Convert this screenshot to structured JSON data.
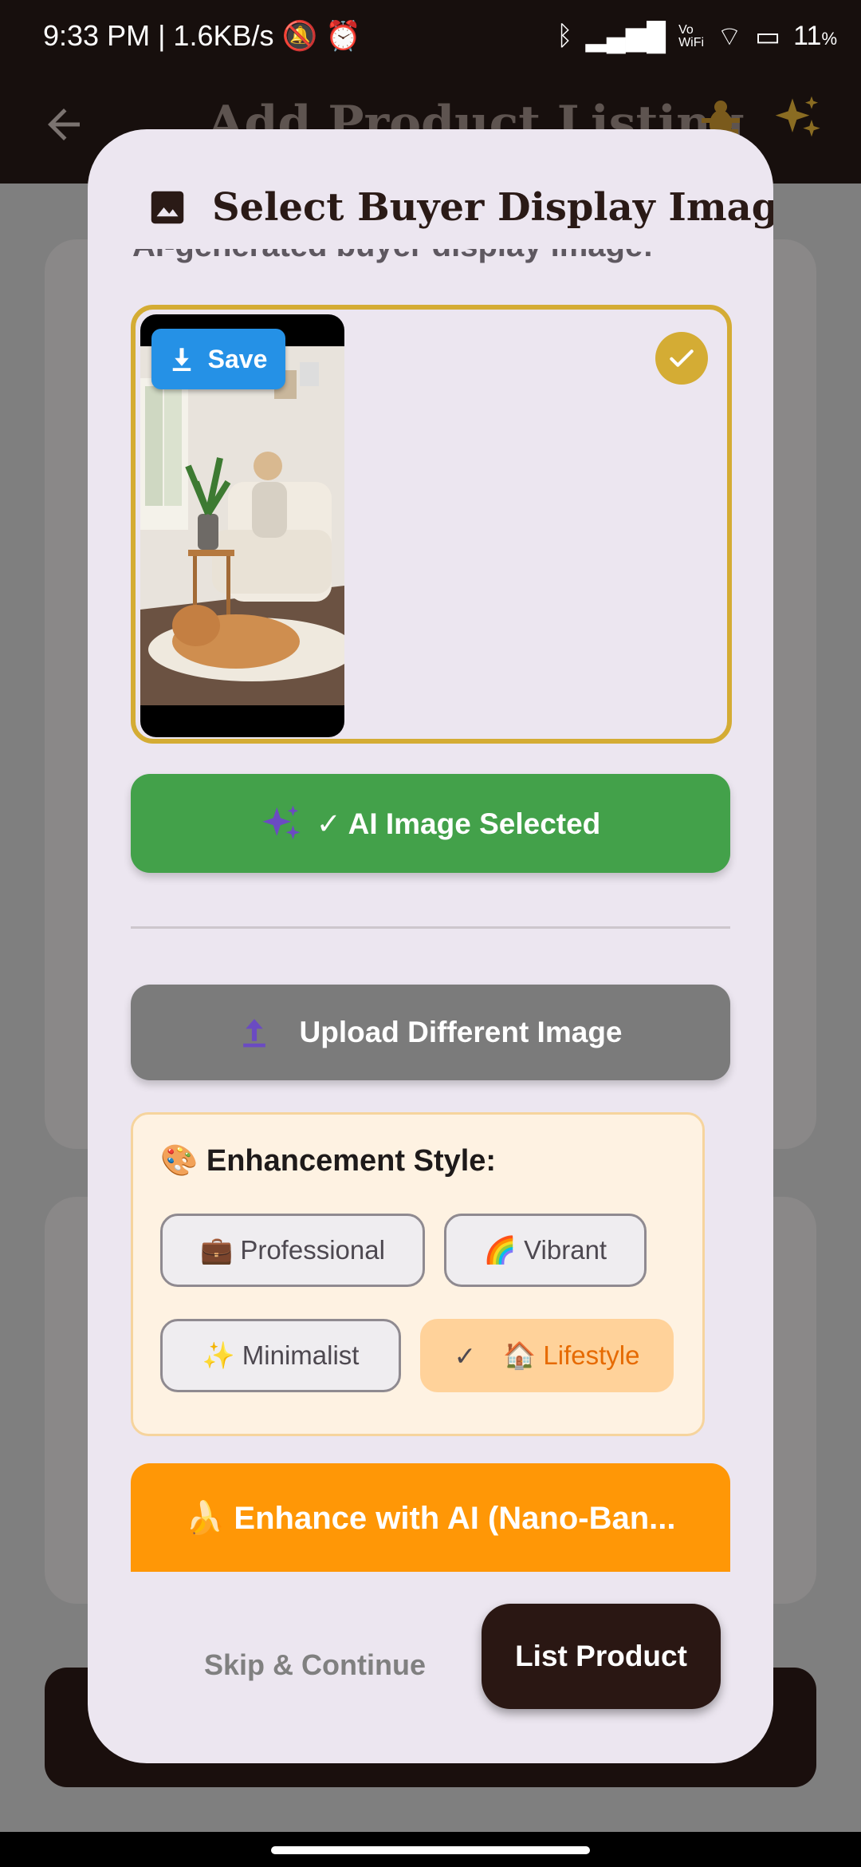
{
  "status_bar": {
    "time_speed": "9:33 PM | 1.6KB/s",
    "vo_wifi_label": "Vo\nWiFi",
    "battery": "11",
    "battery_unit": "%"
  },
  "app_bar": {
    "title": "Add Product Listing"
  },
  "dialog": {
    "title": "Select Buyer Display Image",
    "cut_off_text": "AI-generated buyer display image:",
    "save_label": "Save",
    "ai_selected_label": "✓ AI Image Selected",
    "upload_label": "Upload Different Image",
    "enhancement": {
      "title": "🎨 Enhancement Style:",
      "options": [
        "💼 Professional",
        "🌈 Vibrant",
        "✨ Minimalist",
        "🏠 Lifestyle"
      ],
      "selected_check": "✓",
      "selected": "🏠 Lifestyle"
    },
    "enhance_button": "🍌 Enhance with AI (Nano-Ban...",
    "skip_label": "Skip & Continue",
    "list_label": "List Product"
  },
  "colors": {
    "accent_gold": "#d4ac34",
    "success_green": "#43a14a",
    "save_blue": "#2591e6",
    "enhance_orange": "#ff9706",
    "dark_brown": "#2a1713"
  }
}
